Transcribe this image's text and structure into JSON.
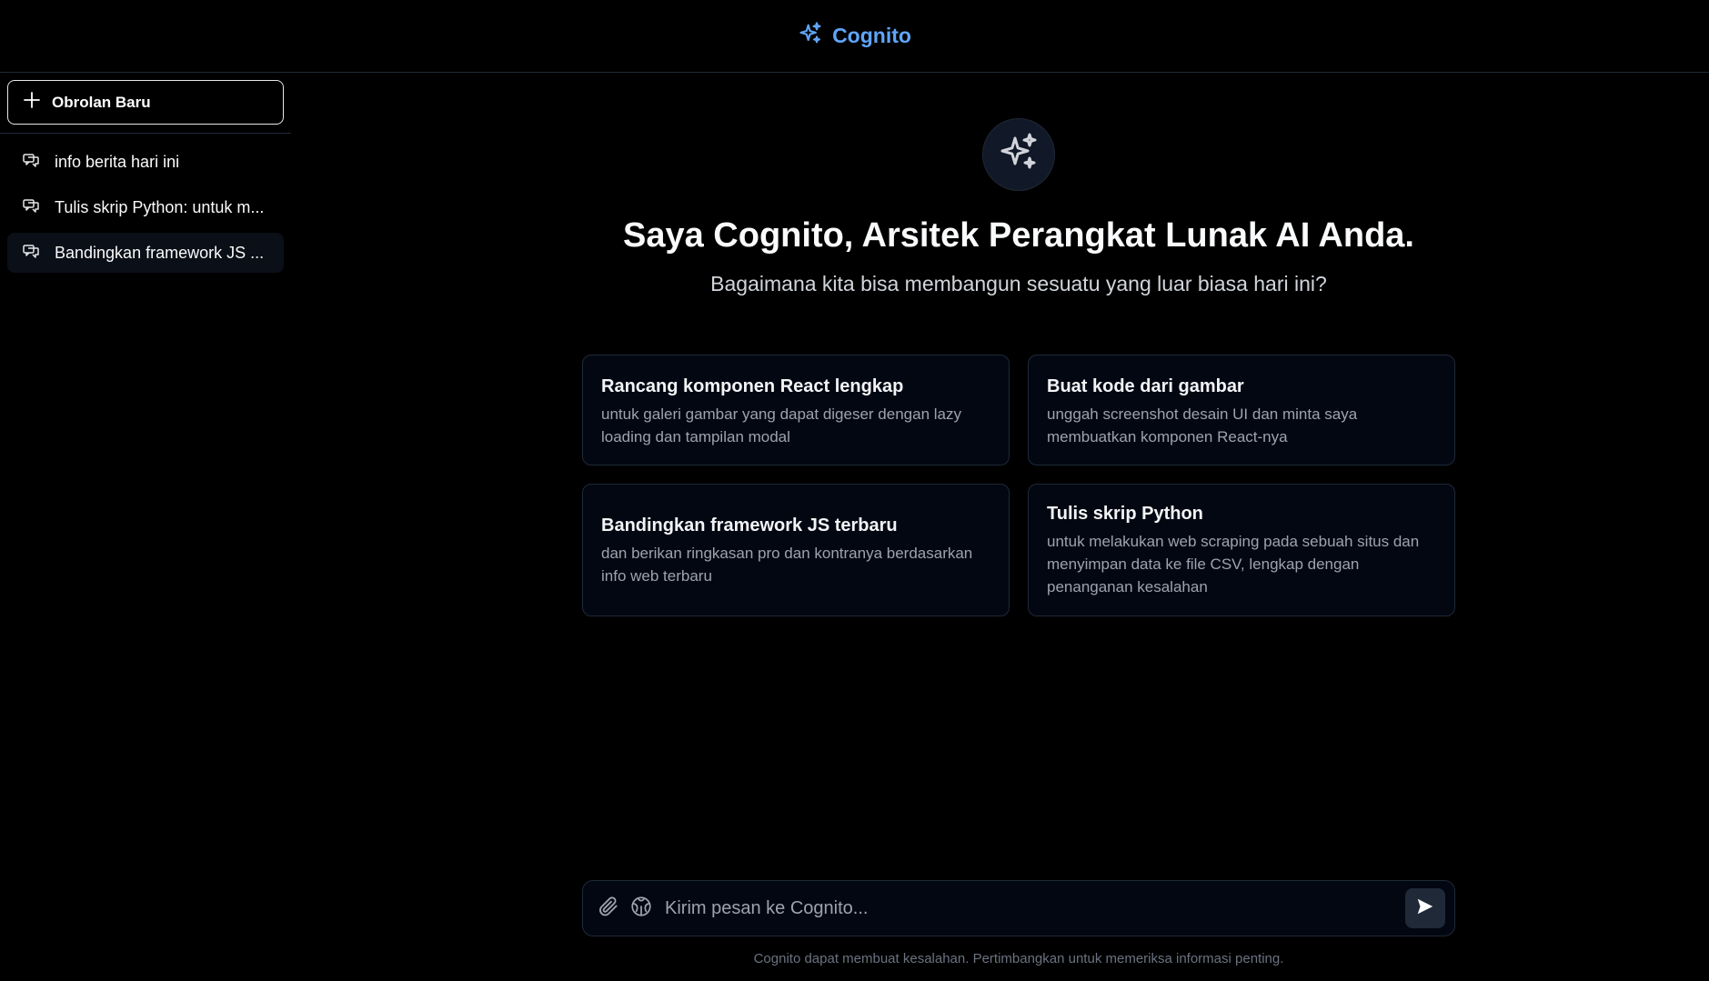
{
  "header": {
    "brand": "Cognito",
    "accent": "#60a5fa"
  },
  "sidebar": {
    "new_chat_label": "Obrolan Baru",
    "history": [
      {
        "label": "info berita hari ini",
        "icon": "chat-bubbles-icon"
      },
      {
        "label": "Tulis skrip Python: untuk m...",
        "icon": "chat-bubbles-icon"
      },
      {
        "label": "Bandingkan framework JS ...",
        "icon": "chat-bubbles-icon",
        "active": true
      }
    ]
  },
  "hero": {
    "icon": "sparkles-icon",
    "title": "Saya Cognito, Arsitek Perangkat Lunak AI Anda.",
    "subtitle": "Bagaimana kita bisa membangun sesuatu yang luar biasa hari ini?"
  },
  "suggestions": [
    {
      "title": "Rancang komponen React lengkap",
      "description": "untuk galeri gambar yang dapat digeser dengan lazy loading dan tampilan modal"
    },
    {
      "title": "Buat kode dari gambar",
      "description": "unggah screenshot desain UI dan minta saya membuatkan komponen React-nya"
    },
    {
      "title": "Bandingkan framework JS terbaru",
      "description": "dan berikan ringkasan pro dan kontranya berdasarkan info web terbaru"
    },
    {
      "title": "Tulis skrip Python",
      "description": "untuk melakukan web scraping pada sebuah situs dan menyimpan data ke file CSV, lengkap dengan penanganan kesalahan"
    }
  ],
  "composer": {
    "placeholder": "Kirim pesan ke Cognito...",
    "value": ""
  },
  "footer": {
    "disclaimer": "Cognito dapat membuat kesalahan. Pertimbangkan untuk memeriksa informasi penting."
  }
}
